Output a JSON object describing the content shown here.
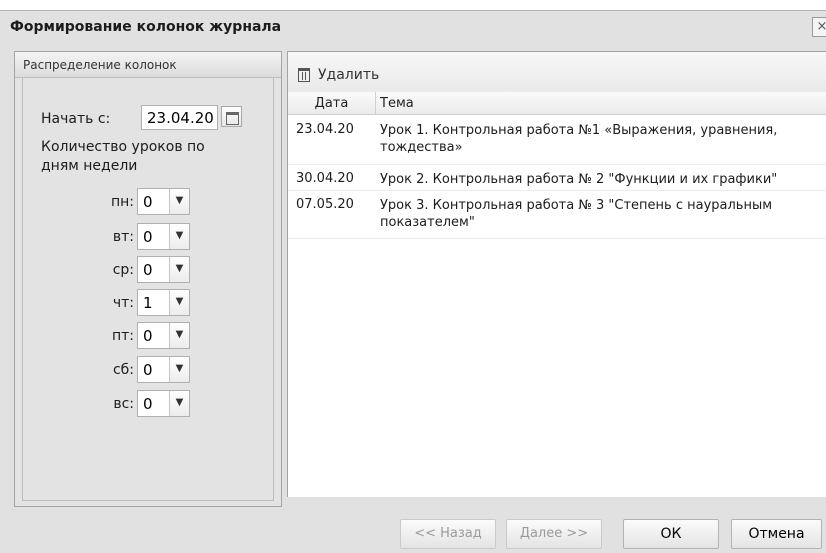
{
  "dialog": {
    "title": "Формирование колонок журнала",
    "close_glyph": "×"
  },
  "left": {
    "header": "Распределение колонок",
    "start_label": "Начать с:",
    "start_date": "23.04.20",
    "lessons_label_line1": "Количество уроков по",
    "lessons_label_line2": "дням недели",
    "days": [
      {
        "label": "пн:",
        "value": "0"
      },
      {
        "label": "вт:",
        "value": "0"
      },
      {
        "label": "ср:",
        "value": "0"
      },
      {
        "label": "чт:",
        "value": "1"
      },
      {
        "label": "пт:",
        "value": "0"
      },
      {
        "label": "сб:",
        "value": "0"
      },
      {
        "label": "вс:",
        "value": "0"
      }
    ]
  },
  "right": {
    "delete_label": "Удалить",
    "columns": {
      "date": "Дата",
      "theme": "Тема"
    },
    "rows": [
      {
        "date": "23.04.20",
        "theme": "Урок 1. Контрольная работа №1 «Выражения, уравнения, тождества»"
      },
      {
        "date": "30.04.20",
        "theme": "Урок 2. Контрольная работа № 2 \"Функции и их графики\""
      },
      {
        "date": "07.05.20",
        "theme": "Урок 3. Контрольная работа № 3 \"Степень с науральным показателем\""
      }
    ]
  },
  "footer": {
    "back_label": "<< Назад",
    "next_label": "Далее >>",
    "ok_label": "ОК",
    "cancel_label": "Отмена"
  }
}
